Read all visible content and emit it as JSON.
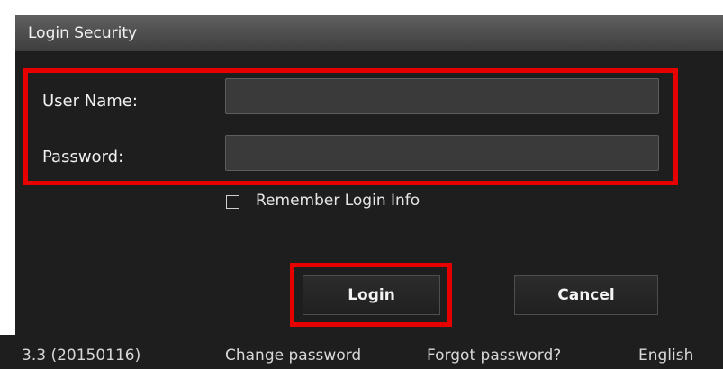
{
  "window": {
    "title": "Login Security"
  },
  "form": {
    "username_label": "User Name:",
    "username_value": "",
    "password_label": "Password:",
    "password_value": "",
    "remember_label": "Remember Login Info",
    "remember_checked": false
  },
  "buttons": {
    "login_label": "Login",
    "cancel_label": "Cancel"
  },
  "footer": {
    "version": "3.3 (20150116)",
    "change_password": "Change password",
    "forgot_password": "Forgot password?",
    "language": "English"
  },
  "colors": {
    "highlight": "#e60000",
    "background": "#1e1e1e",
    "titlebar": "#4a4a4a"
  }
}
